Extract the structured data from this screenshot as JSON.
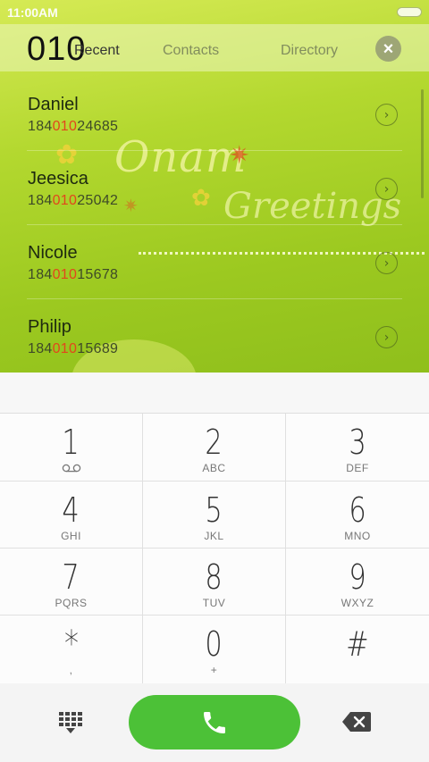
{
  "status_bar": {
    "time": "11:00AM"
  },
  "header": {
    "dialed_number": "010",
    "tabs": [
      {
        "label": "Recent"
      },
      {
        "label": "Contacts"
      },
      {
        "label": "Directory"
      }
    ]
  },
  "wallpaper": {
    "line1": "Onam",
    "line2": "Greetings"
  },
  "results": [
    {
      "name": "Daniel",
      "number_prefix": "184",
      "number_match": "010",
      "number_suffix": "24685"
    },
    {
      "name": "Jeesica",
      "number_prefix": "184",
      "number_match": "010",
      "number_suffix": "25042"
    },
    {
      "name": "Nicole",
      "number_prefix": "184",
      "number_match": "010",
      "number_suffix": "15678"
    },
    {
      "name": "Philip",
      "number_prefix": "184",
      "number_match": "010",
      "number_suffix": "15689"
    }
  ],
  "highlight_color": "#e2461c",
  "call_button_color": "#4cc137",
  "keypad": [
    {
      "digit": "1",
      "sub": "",
      "sub_icon": "voicemail-icon"
    },
    {
      "digit": "2",
      "sub": "ABC"
    },
    {
      "digit": "3",
      "sub": "DEF"
    },
    {
      "digit": "4",
      "sub": "GHI"
    },
    {
      "digit": "5",
      "sub": "JKL"
    },
    {
      "digit": "6",
      "sub": "MNO"
    },
    {
      "digit": "7",
      "sub": "PQRS"
    },
    {
      "digit": "8",
      "sub": "TUV"
    },
    {
      "digit": "9",
      "sub": "WXYZ"
    },
    {
      "digit": "*",
      "sub": ","
    },
    {
      "digit": "0",
      "sub": "+"
    },
    {
      "digit": "#",
      "sub": ""
    }
  ],
  "actions": {
    "keypad_toggle_icon": "dialpad-icon",
    "call_icon": "phone-icon",
    "backspace_icon": "backspace-icon"
  }
}
